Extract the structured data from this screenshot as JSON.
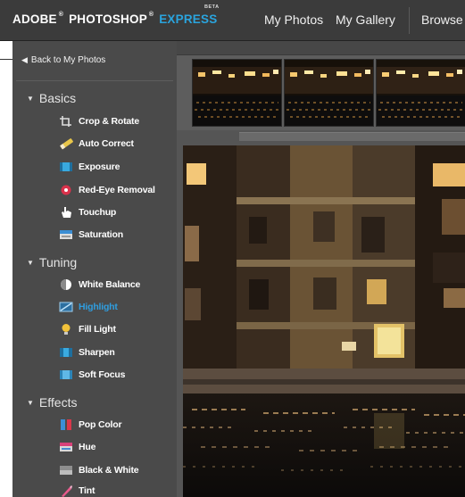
{
  "header": {
    "brand_adobe": "ADOBE",
    "brand_photoshop": "PHOTOSHOP",
    "brand_express": "EXPRESS",
    "brand_reg": "®",
    "beta": "BETA",
    "nav": [
      {
        "label": "My Photos"
      },
      {
        "label": "My Gallery"
      },
      {
        "label": "Browse"
      }
    ]
  },
  "sidebar": {
    "back_label": "Back to My Photos",
    "sections": [
      {
        "title": "Basics",
        "tools": [
          {
            "label": "Crop & Rotate",
            "icon": "crop-icon"
          },
          {
            "label": "Auto Correct",
            "icon": "wand-icon"
          },
          {
            "label": "Exposure",
            "icon": "exposure-icon"
          },
          {
            "label": "Red-Eye Removal",
            "icon": "red-eye-icon"
          },
          {
            "label": "Touchup",
            "icon": "hand-icon"
          },
          {
            "label": "Saturation",
            "icon": "saturation-icon"
          }
        ]
      },
      {
        "title": "Tuning",
        "tools": [
          {
            "label": "White Balance",
            "icon": "white-balance-icon"
          },
          {
            "label": "Highlight",
            "icon": "highlight-icon",
            "active": true
          },
          {
            "label": "Fill Light",
            "icon": "bulb-icon"
          },
          {
            "label": "Sharpen",
            "icon": "sharpen-icon"
          },
          {
            "label": "Soft Focus",
            "icon": "soft-focus-icon"
          }
        ]
      },
      {
        "title": "Effects",
        "tools": [
          {
            "label": "Pop Color",
            "icon": "pop-color-icon"
          },
          {
            "label": "Hue",
            "icon": "hue-icon"
          },
          {
            "label": "Black & White",
            "icon": "black-white-icon"
          },
          {
            "label": "Tint",
            "icon": "tint-icon"
          }
        ]
      }
    ]
  },
  "colors": {
    "header_bg": "#3b3b3b",
    "sidebar_bg": "#4a4a4a",
    "accent": "#2aa4de",
    "active_tool": "#2f9ee0"
  }
}
